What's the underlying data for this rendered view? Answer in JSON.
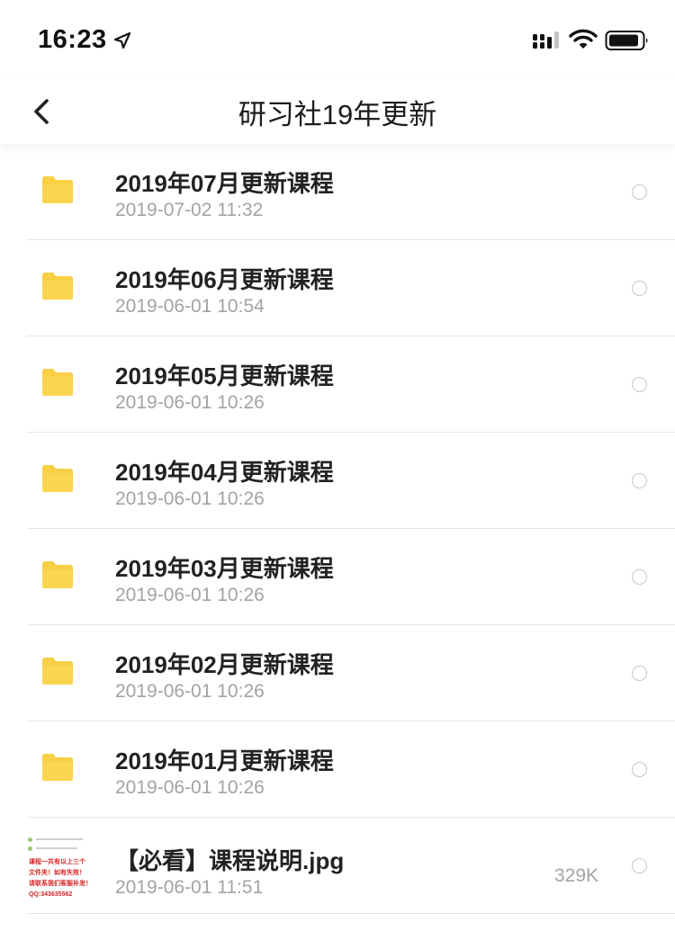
{
  "status_bar": {
    "time": "16:23",
    "icons": [
      "location-arrow-icon",
      "cellular-signal-icon",
      "wifi-icon",
      "battery-icon"
    ]
  },
  "nav": {
    "title": "研习社19年更新",
    "back_icon": "chevron-left-icon"
  },
  "colors": {
    "folder": "#F9CF43",
    "text_primary": "#222222",
    "text_secondary": "#A3A3A3",
    "divider": "#E6E6E6"
  },
  "items": [
    {
      "type": "folder",
      "name": "2019年07月更新课程",
      "date": "2019-07-02 11:32"
    },
    {
      "type": "folder",
      "name": "2019年06月更新课程",
      "date": "2019-06-01 10:54"
    },
    {
      "type": "folder",
      "name": "2019年05月更新课程",
      "date": "2019-06-01 10:26"
    },
    {
      "type": "folder",
      "name": "2019年04月更新课程",
      "date": "2019-06-01 10:26"
    },
    {
      "type": "folder",
      "name": "2019年03月更新课程",
      "date": "2019-06-01 10:26"
    },
    {
      "type": "folder",
      "name": "2019年02月更新课程",
      "date": "2019-06-01 10:26"
    },
    {
      "type": "folder",
      "name": "2019年01月更新课程",
      "date": "2019-06-01 10:26"
    },
    {
      "type": "image",
      "name": "【必看】课程说明.jpg",
      "date": "2019-06-01 11:51",
      "size": "329K",
      "thumbnail_text": [
        "课程一共有以上三个",
        "文件夹！如有失效！",
        "请联系我们客服补发！",
        "QQ:343635562"
      ]
    }
  ]
}
